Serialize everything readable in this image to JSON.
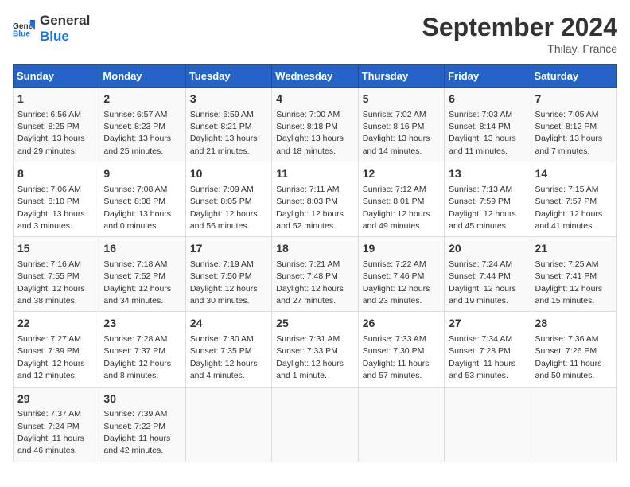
{
  "logo": {
    "line1": "General",
    "line2": "Blue"
  },
  "title": "September 2024",
  "subtitle": "Thilay, France",
  "days_header": [
    "Sunday",
    "Monday",
    "Tuesday",
    "Wednesday",
    "Thursday",
    "Friday",
    "Saturday"
  ],
  "weeks": [
    [
      {
        "day": "1",
        "text": "Sunrise: 6:56 AM\nSunset: 8:25 PM\nDaylight: 13 hours\nand 29 minutes."
      },
      {
        "day": "2",
        "text": "Sunrise: 6:57 AM\nSunset: 8:23 PM\nDaylight: 13 hours\nand 25 minutes."
      },
      {
        "day": "3",
        "text": "Sunrise: 6:59 AM\nSunset: 8:21 PM\nDaylight: 13 hours\nand 21 minutes."
      },
      {
        "day": "4",
        "text": "Sunrise: 7:00 AM\nSunset: 8:18 PM\nDaylight: 13 hours\nand 18 minutes."
      },
      {
        "day": "5",
        "text": "Sunrise: 7:02 AM\nSunset: 8:16 PM\nDaylight: 13 hours\nand 14 minutes."
      },
      {
        "day": "6",
        "text": "Sunrise: 7:03 AM\nSunset: 8:14 PM\nDaylight: 13 hours\nand 11 minutes."
      },
      {
        "day": "7",
        "text": "Sunrise: 7:05 AM\nSunset: 8:12 PM\nDaylight: 13 hours\nand 7 minutes."
      }
    ],
    [
      {
        "day": "8",
        "text": "Sunrise: 7:06 AM\nSunset: 8:10 PM\nDaylight: 13 hours\nand 3 minutes."
      },
      {
        "day": "9",
        "text": "Sunrise: 7:08 AM\nSunset: 8:08 PM\nDaylight: 13 hours\nand 0 minutes."
      },
      {
        "day": "10",
        "text": "Sunrise: 7:09 AM\nSunset: 8:05 PM\nDaylight: 12 hours\nand 56 minutes."
      },
      {
        "day": "11",
        "text": "Sunrise: 7:11 AM\nSunset: 8:03 PM\nDaylight: 12 hours\nand 52 minutes."
      },
      {
        "day": "12",
        "text": "Sunrise: 7:12 AM\nSunset: 8:01 PM\nDaylight: 12 hours\nand 49 minutes."
      },
      {
        "day": "13",
        "text": "Sunrise: 7:13 AM\nSunset: 7:59 PM\nDaylight: 12 hours\nand 45 minutes."
      },
      {
        "day": "14",
        "text": "Sunrise: 7:15 AM\nSunset: 7:57 PM\nDaylight: 12 hours\nand 41 minutes."
      }
    ],
    [
      {
        "day": "15",
        "text": "Sunrise: 7:16 AM\nSunset: 7:55 PM\nDaylight: 12 hours\nand 38 minutes."
      },
      {
        "day": "16",
        "text": "Sunrise: 7:18 AM\nSunset: 7:52 PM\nDaylight: 12 hours\nand 34 minutes."
      },
      {
        "day": "17",
        "text": "Sunrise: 7:19 AM\nSunset: 7:50 PM\nDaylight: 12 hours\nand 30 minutes."
      },
      {
        "day": "18",
        "text": "Sunrise: 7:21 AM\nSunset: 7:48 PM\nDaylight: 12 hours\nand 27 minutes."
      },
      {
        "day": "19",
        "text": "Sunrise: 7:22 AM\nSunset: 7:46 PM\nDaylight: 12 hours\nand 23 minutes."
      },
      {
        "day": "20",
        "text": "Sunrise: 7:24 AM\nSunset: 7:44 PM\nDaylight: 12 hours\nand 19 minutes."
      },
      {
        "day": "21",
        "text": "Sunrise: 7:25 AM\nSunset: 7:41 PM\nDaylight: 12 hours\nand 15 minutes."
      }
    ],
    [
      {
        "day": "22",
        "text": "Sunrise: 7:27 AM\nSunset: 7:39 PM\nDaylight: 12 hours\nand 12 minutes."
      },
      {
        "day": "23",
        "text": "Sunrise: 7:28 AM\nSunset: 7:37 PM\nDaylight: 12 hours\nand 8 minutes."
      },
      {
        "day": "24",
        "text": "Sunrise: 7:30 AM\nSunset: 7:35 PM\nDaylight: 12 hours\nand 4 minutes."
      },
      {
        "day": "25",
        "text": "Sunrise: 7:31 AM\nSunset: 7:33 PM\nDaylight: 12 hours\nand 1 minute."
      },
      {
        "day": "26",
        "text": "Sunrise: 7:33 AM\nSunset: 7:30 PM\nDaylight: 11 hours\nand 57 minutes."
      },
      {
        "day": "27",
        "text": "Sunrise: 7:34 AM\nSunset: 7:28 PM\nDaylight: 11 hours\nand 53 minutes."
      },
      {
        "day": "28",
        "text": "Sunrise: 7:36 AM\nSunset: 7:26 PM\nDaylight: 11 hours\nand 50 minutes."
      }
    ],
    [
      {
        "day": "29",
        "text": "Sunrise: 7:37 AM\nSunset: 7:24 PM\nDaylight: 11 hours\nand 46 minutes."
      },
      {
        "day": "30",
        "text": "Sunrise: 7:39 AM\nSunset: 7:22 PM\nDaylight: 11 hours\nand 42 minutes."
      },
      null,
      null,
      null,
      null,
      null
    ]
  ]
}
